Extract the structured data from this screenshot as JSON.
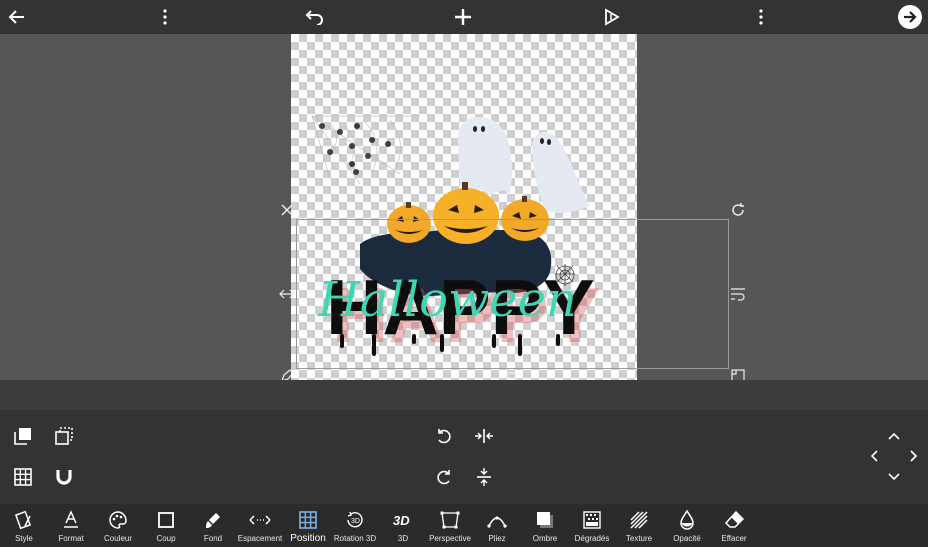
{
  "toolbar": {
    "items": [
      {
        "label": "Style",
        "icon": "style-icon"
      },
      {
        "label": "Format",
        "icon": "format-icon"
      },
      {
        "label": "Couleur",
        "icon": "palette-icon"
      },
      {
        "label": "Coup",
        "icon": "stroke-square-icon"
      },
      {
        "label": "Fond",
        "icon": "brush-icon"
      },
      {
        "label": "Espacement",
        "icon": "spacing-icon"
      },
      {
        "label": "Position",
        "icon": "grid-icon",
        "active": true
      },
      {
        "label": "Rotation 3D",
        "icon": "rotation-3d-icon"
      },
      {
        "label": "3D",
        "icon": "3d-icon"
      },
      {
        "label": "Perspective",
        "icon": "perspective-icon"
      },
      {
        "label": "Pliez",
        "icon": "bend-icon"
      },
      {
        "label": "Ombre",
        "icon": "shadow-icon"
      },
      {
        "label": "Dégradés",
        "icon": "gradient-icon"
      },
      {
        "label": "Texture",
        "icon": "texture-icon"
      },
      {
        "label": "Opacité",
        "icon": "opacity-icon"
      },
      {
        "label": "Effacer",
        "icon": "eraser-icon"
      }
    ]
  },
  "canvas": {
    "word_happy": "HAPPY",
    "word_halloween": "Halloween",
    "colors": {
      "happy": "#0d0d0d",
      "halloween_teal": "#3fd6b4",
      "halloween_gold": "#c9a24a",
      "shadow": "#d9484a",
      "accent_active": "#7fb2e6"
    }
  }
}
